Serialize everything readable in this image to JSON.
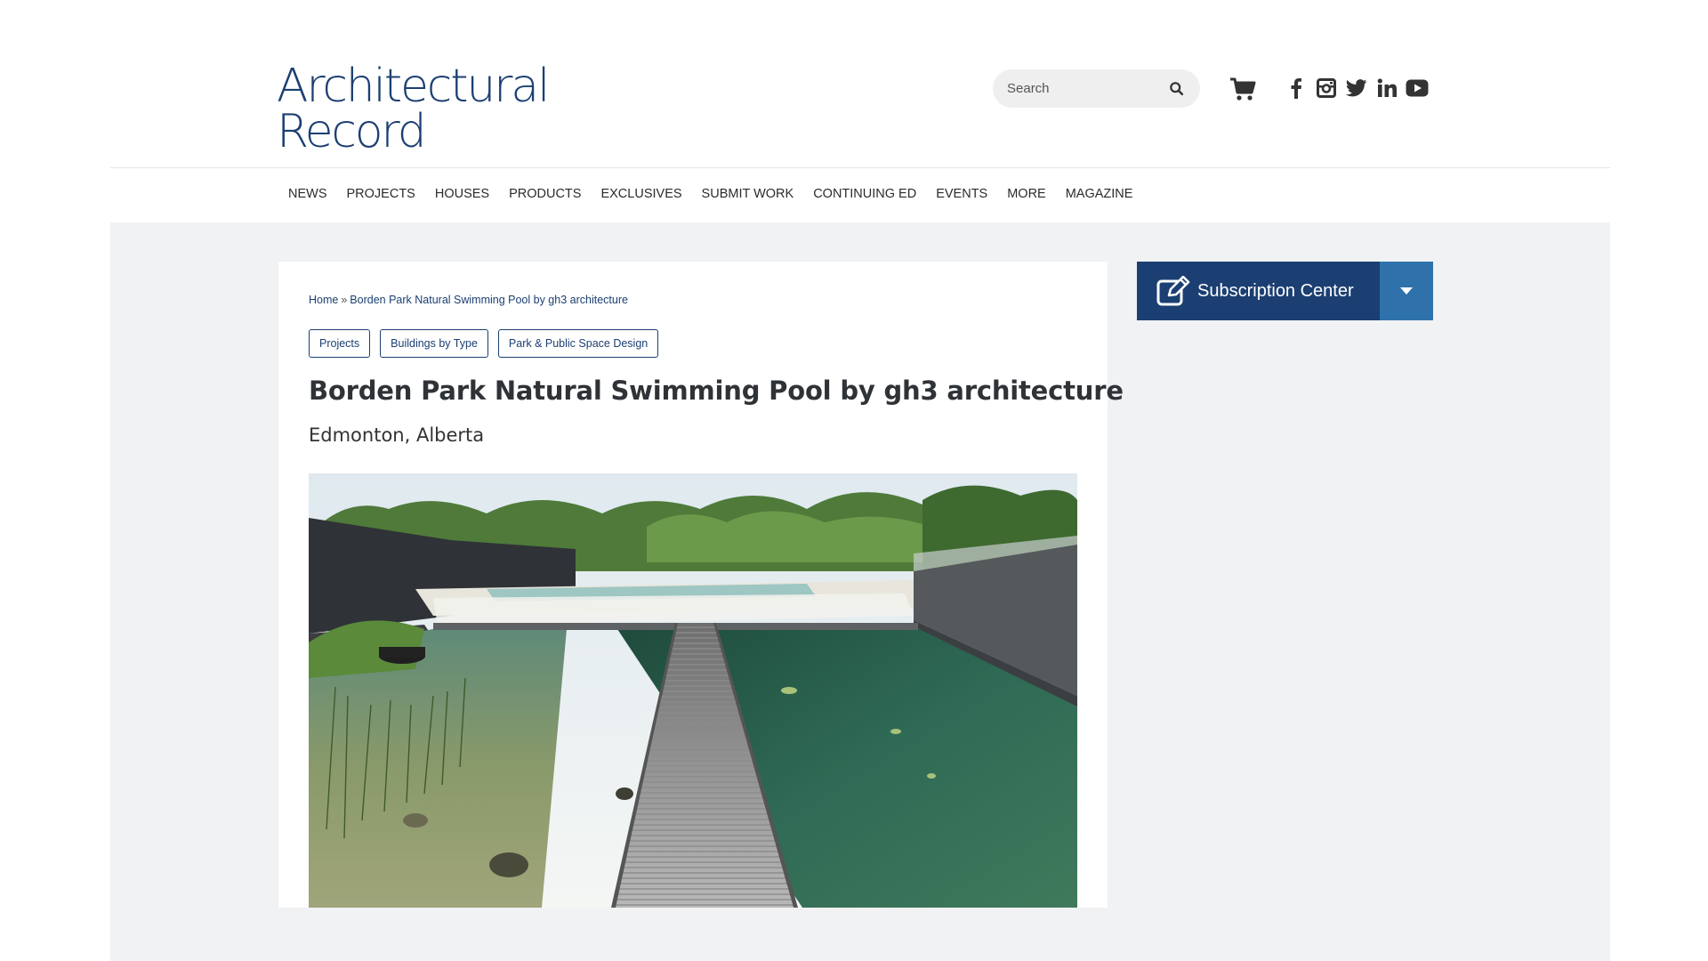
{
  "header": {
    "logo_line1": "Architectural",
    "logo_line2": "Record",
    "search": {
      "placeholder": "Search"
    },
    "social_icons": [
      "facebook-icon",
      "instagram-icon",
      "twitter-icon",
      "linkedin-icon",
      "youtube-icon"
    ]
  },
  "nav": {
    "items": [
      "NEWS",
      "PROJECTS",
      "HOUSES",
      "PRODUCTS",
      "EXCLUSIVES",
      "SUBMIT WORK",
      "CONTINUING ED",
      "EVENTS",
      "MORE",
      "MAGAZINE"
    ]
  },
  "article": {
    "breadcrumb": {
      "home": "Home",
      "separator": "»",
      "current": "Borden Park Natural Swimming Pool by gh3 architecture"
    },
    "tags": [
      "Projects",
      "Buildings by Type",
      "Park & Public Space Design"
    ],
    "title": "Borden Park Natural Swimming Pool by gh3 architecture",
    "location": "Edmonton, Alberta"
  },
  "sidebar": {
    "subscription_label": "Subscription Center"
  },
  "colors": {
    "brand_navy": "#1b3f72",
    "toggle_blue": "#2f72ab",
    "content_bg": "#f1f2f4"
  }
}
